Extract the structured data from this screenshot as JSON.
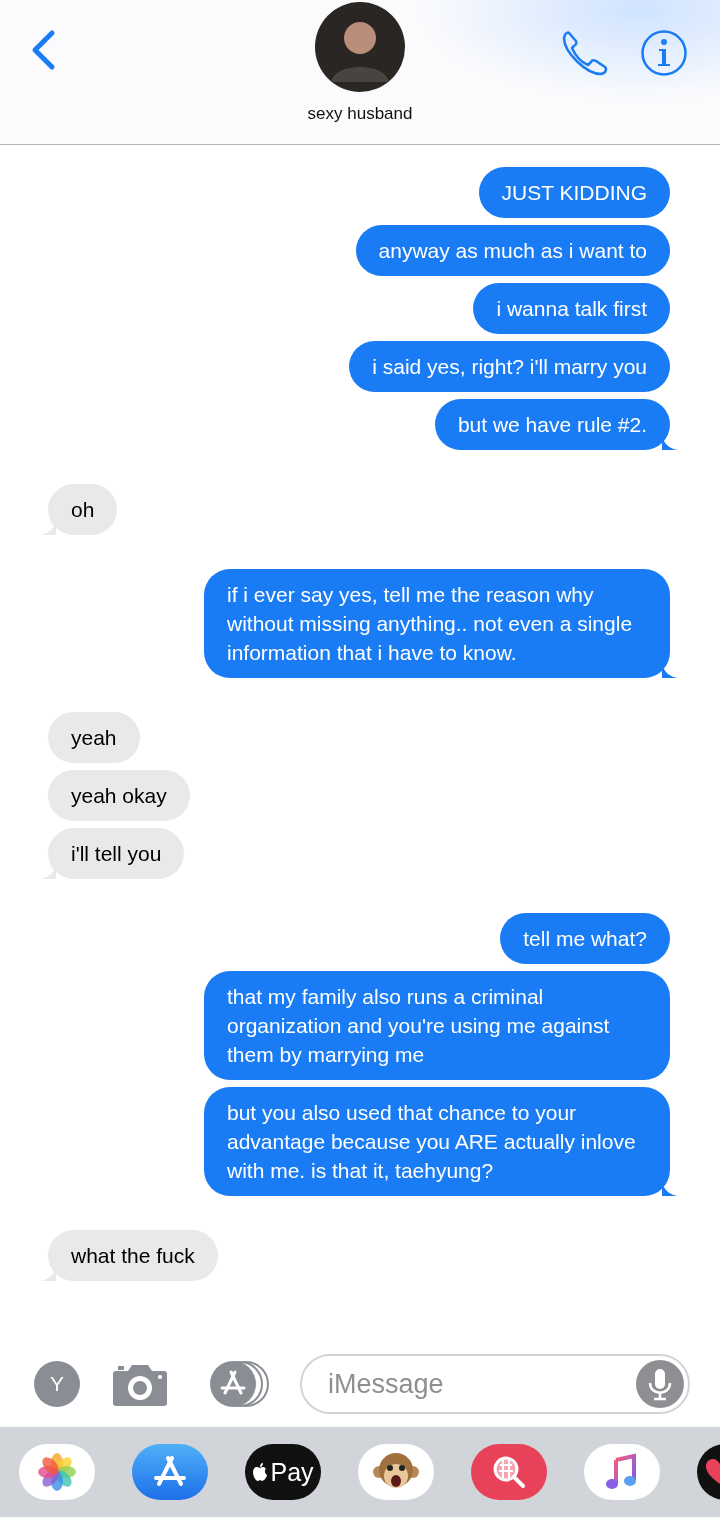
{
  "header": {
    "contact_name": "sexy husband"
  },
  "messages": [
    {
      "kind": "sent",
      "text": "JUST KIDDING",
      "tail": false
    },
    {
      "kind": "sent",
      "text": "anyway as much as i want to",
      "tail": false
    },
    {
      "kind": "sent",
      "text": "i wanna talk first",
      "tail": false
    },
    {
      "kind": "sent",
      "text": "i said yes, right? i'll marry you",
      "tail": false
    },
    {
      "kind": "sent",
      "text": "but we have rule #2.",
      "tail": true
    },
    {
      "kind": "received",
      "text": "oh",
      "tail": true
    },
    {
      "kind": "sent",
      "text": "if i ever say yes, tell me the reason why without missing anything.. not even a single information that i have to know.",
      "tail": true
    },
    {
      "kind": "received",
      "text": "yeah",
      "tail": false
    },
    {
      "kind": "received",
      "text": "yeah okay",
      "tail": false
    },
    {
      "kind": "received",
      "text": "i'll tell you",
      "tail": true
    },
    {
      "kind": "sent",
      "text": "tell me what?",
      "tail": false
    },
    {
      "kind": "sent",
      "text": "that my family also runs a criminal organization and you're using me against them by marrying me",
      "tail": false
    },
    {
      "kind": "sent",
      "text": "but you also used that chance to your advantage because you ARE actually inlove with me. is that it, taehyung?",
      "tail": true
    },
    {
      "kind": "received",
      "text": "what the fuck",
      "tail": true
    }
  ],
  "composer": {
    "avatar_letter": "Y",
    "placeholder": "iMessage"
  },
  "app_drawer": [
    {
      "kind": "photos"
    },
    {
      "kind": "appstore"
    },
    {
      "kind": "applepay",
      "label": "Pay"
    },
    {
      "kind": "animoji"
    },
    {
      "kind": "search"
    },
    {
      "kind": "music"
    },
    {
      "kind": "heart"
    }
  ]
}
